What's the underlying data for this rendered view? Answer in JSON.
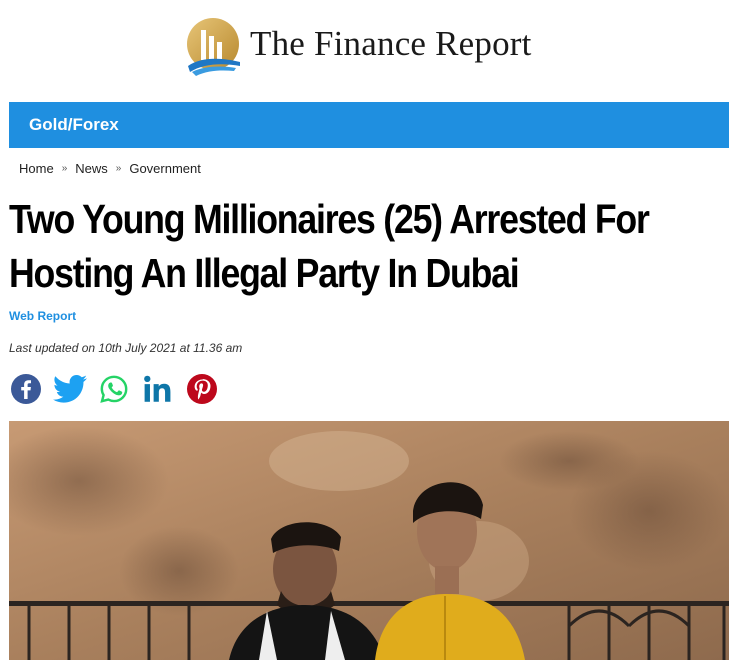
{
  "site": {
    "name": "The Finance Report",
    "logo_icon": "finance-report-logo-icon"
  },
  "category": {
    "label": "Gold/Forex",
    "color": "#1f8fe0"
  },
  "breadcrumb": {
    "items": [
      "Home",
      "News",
      "Government"
    ],
    "separator": "»"
  },
  "article": {
    "headline_line1": "Two Young Millionaires (25) Arrested For",
    "headline_line2": "Hosting An Illegal Party In Dubai",
    "author": "Web Report",
    "updated": "Last updated on 10th July 2021 at 11.36 am"
  },
  "share": {
    "buttons": [
      {
        "name": "facebook-icon",
        "color": "#3b5998"
      },
      {
        "name": "twitter-icon",
        "color": "#1da1f2"
      },
      {
        "name": "whatsapp-icon",
        "color": "#25d366"
      },
      {
        "name": "linkedin-icon",
        "color": "#0e76a8"
      },
      {
        "name": "pinterest-icon",
        "color": "#bd081c"
      }
    ]
  },
  "hero": {
    "image": "photo-two-young-men-seated-map-backdrop"
  }
}
